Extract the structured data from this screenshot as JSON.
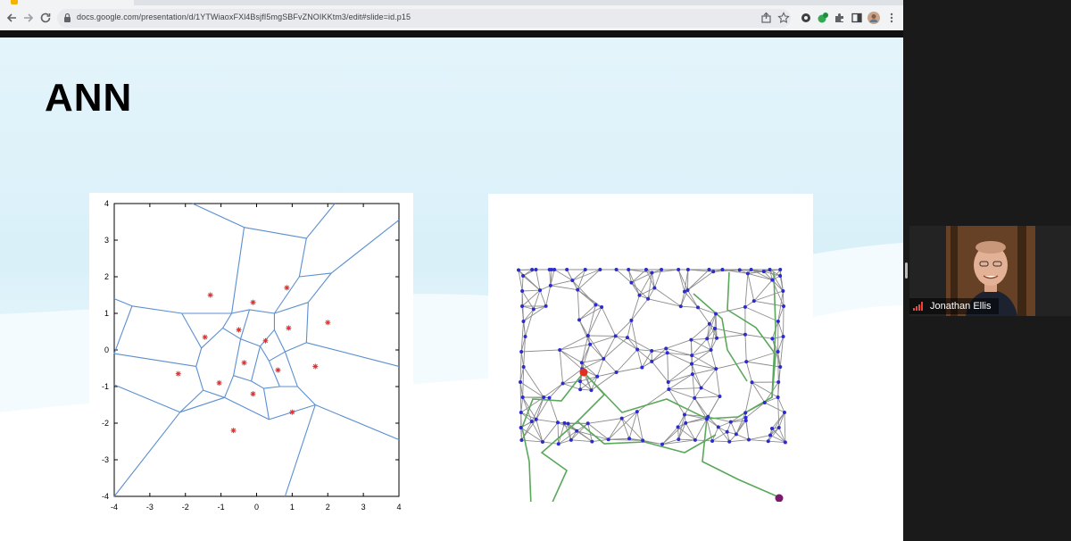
{
  "browser": {
    "url": "docs.google.com/presentation/d/1YTWiaoxFXl4BsjfI5mgSBFvZNOIKKtm3/edit#slide=id.p15",
    "nav": {
      "back_icon": "arrow-left-icon",
      "forward_icon": "arrow-right-icon",
      "reload_icon": "reload-icon"
    },
    "toolbar_icons": [
      "share-icon",
      "star-icon",
      "extension-icon",
      "extension-icon",
      "puzzle-icon",
      "sidebar-icon",
      "profile-avatar",
      "more-vert-icon"
    ]
  },
  "slide": {
    "title": "ANN",
    "voronoi_plot": {
      "x_ticks": [
        "-4",
        "-3",
        "-2",
        "-1",
        "0",
        "1",
        "2",
        "3",
        "4"
      ],
      "y_ticks": [
        "4",
        "3",
        "2",
        "1",
        "0",
        "-1",
        "-2",
        "-3",
        "-4"
      ],
      "xlim": [
        -4,
        4
      ],
      "ylim": [
        -4,
        4
      ],
      "site_color": "#e03030",
      "edge_color": "#5b8fd0"
    },
    "graph_figure": {
      "node_color": "#2b2bd0",
      "edge_color": "#8c8c8c",
      "path_color": "#5aa85a",
      "start_node_color": "#e03020",
      "end_node_color": "#7a1a6e"
    }
  },
  "participant": {
    "name": "Jonathan Ellis",
    "signal_icon": "signal-bars-icon"
  }
}
